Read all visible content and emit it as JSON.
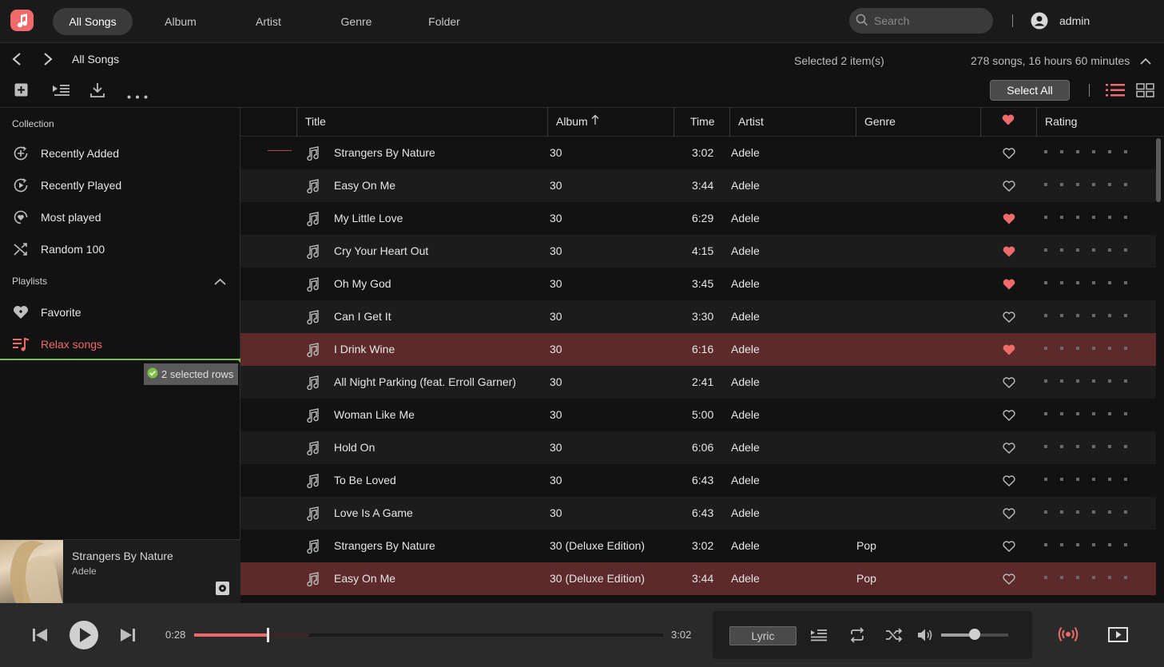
{
  "nav": {
    "tabs": [
      {
        "label": "All Songs",
        "active": true
      },
      {
        "label": "Album",
        "active": false
      },
      {
        "label": "Artist",
        "active": false
      },
      {
        "label": "Genre",
        "active": false
      },
      {
        "label": "Folder",
        "active": false
      }
    ],
    "search_placeholder": "Search",
    "user": "admin"
  },
  "subbar": {
    "breadcrumb": "All Songs",
    "selected_text": "Selected 2 item(s)",
    "summary": "278 songs, 16 hours 60 minutes",
    "select_all": "Select All"
  },
  "sidebar": {
    "collection_title": "Collection",
    "collection": [
      "Recently Added",
      "Recently Played",
      "Most played",
      "Random 100"
    ],
    "playlists_title": "Playlists",
    "playlists": [
      "Favorite",
      "Relax songs"
    ],
    "drag_badge": "2 selected rows"
  },
  "table": {
    "headers": {
      "title": "Title",
      "album": "Album",
      "time": "Time",
      "artist": "Artist",
      "genre": "Genre",
      "rating": "Rating"
    },
    "rows": [
      {
        "title": "Strangers By Nature",
        "album": "30",
        "time": "3:02",
        "artist": "Adele",
        "genre": "",
        "favorite": false,
        "selected": false
      },
      {
        "title": "Easy On Me",
        "album": "30",
        "time": "3:44",
        "artist": "Adele",
        "genre": "",
        "favorite": false,
        "selected": false
      },
      {
        "title": "My Little Love",
        "album": "30",
        "time": "6:29",
        "artist": "Adele",
        "genre": "",
        "favorite": true,
        "selected": false
      },
      {
        "title": "Cry Your Heart Out",
        "album": "30",
        "time": "4:15",
        "artist": "Adele",
        "genre": "",
        "favorite": true,
        "selected": false
      },
      {
        "title": "Oh My God",
        "album": "30",
        "time": "3:45",
        "artist": "Adele",
        "genre": "",
        "favorite": true,
        "selected": false
      },
      {
        "title": "Can I Get It",
        "album": "30",
        "time": "3:30",
        "artist": "Adele",
        "genre": "",
        "favorite": false,
        "selected": false
      },
      {
        "title": "I Drink Wine",
        "album": "30",
        "time": "6:16",
        "artist": "Adele",
        "genre": "",
        "favorite": true,
        "selected": true
      },
      {
        "title": "All Night Parking (feat. Erroll Garner)",
        "album": "30",
        "time": "2:41",
        "artist": "Adele",
        "genre": "",
        "favorite": false,
        "selected": false
      },
      {
        "title": "Woman Like Me",
        "album": "30",
        "time": "5:00",
        "artist": "Adele",
        "genre": "",
        "favorite": false,
        "selected": false
      },
      {
        "title": "Hold On",
        "album": "30",
        "time": "6:06",
        "artist": "Adele",
        "genre": "",
        "favorite": false,
        "selected": false
      },
      {
        "title": "To Be Loved",
        "album": "30",
        "time": "6:43",
        "artist": "Adele",
        "genre": "",
        "favorite": false,
        "selected": false
      },
      {
        "title": "Love Is A Game",
        "album": "30",
        "time": "6:43",
        "artist": "Adele",
        "genre": "",
        "favorite": false,
        "selected": false
      },
      {
        "title": "Strangers By Nature",
        "album": "30 (Deluxe Edition)",
        "time": "3:02",
        "artist": "Adele",
        "genre": "Pop",
        "favorite": false,
        "selected": false
      },
      {
        "title": "Easy On Me",
        "album": "30 (Deluxe Edition)",
        "time": "3:44",
        "artist": "Adele",
        "genre": "Pop",
        "favorite": false,
        "selected": true
      }
    ]
  },
  "now_playing": {
    "title": "Strangers By Nature",
    "artist": "Adele"
  },
  "player": {
    "elapsed": "0:28",
    "duration": "3:02",
    "progress": 0.155,
    "buffered": 0.245,
    "volume": 0.5,
    "lyric_label": "Lyric"
  },
  "colors": {
    "accent": "#ef6b6b",
    "selected_row": "#5c2a2a",
    "drop_line": "#7bc043"
  }
}
